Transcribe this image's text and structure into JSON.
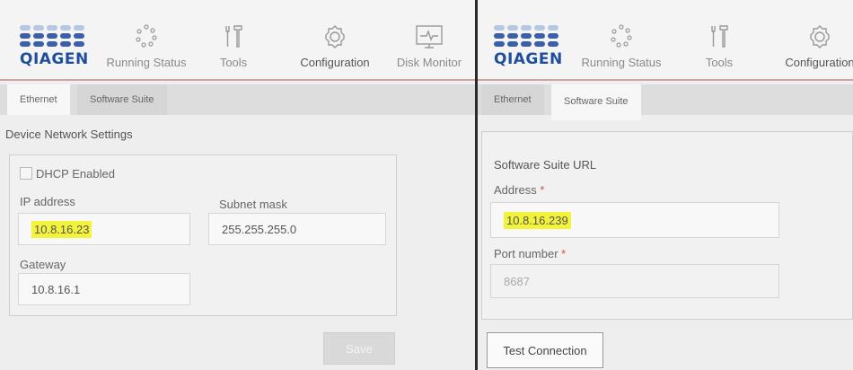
{
  "brand": {
    "logo_text": "QIAGEN"
  },
  "nav": {
    "running_status": "Running Status",
    "tools": "Tools",
    "configuration": "Configuration",
    "disk_monitor": "Disk Monitor"
  },
  "tabs": {
    "ethernet": "Ethernet",
    "software_suite": "Software Suite"
  },
  "ethernet_screen": {
    "section_title": "Device Network Settings",
    "dhcp_label": "DHCP Enabled",
    "dhcp_checked": false,
    "ip_label": "IP address",
    "ip_value": "10.8.16.23",
    "subnet_label": "Subnet mask",
    "subnet_value": "255.255.255.0",
    "gateway_label": "Gateway",
    "gateway_value": "10.8.16.1",
    "save_label": "Save"
  },
  "software_suite_screen": {
    "section_title": "Software Suite URL",
    "address_label": "Address",
    "address_value": "10.8.16.239",
    "port_label": "Port number",
    "port_value": "8687",
    "required_marker": "*",
    "test_connection_label": "Test Connection"
  },
  "colors": {
    "brand_blue": "#1f4f9c",
    "highlight": "#f2f33a",
    "required": "#c85050"
  }
}
